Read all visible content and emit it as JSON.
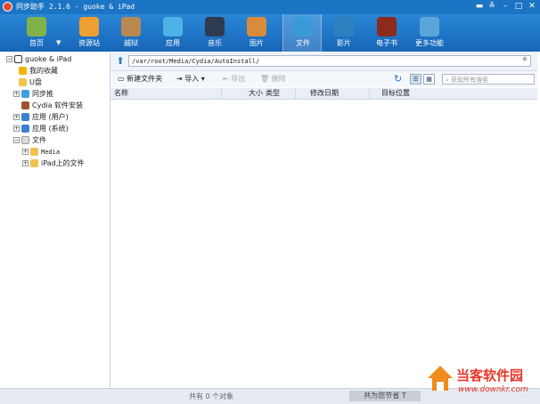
{
  "window": {
    "title": "同步助手 2.1.6 - guoke & iPad"
  },
  "toolbar": {
    "items": [
      {
        "label": "首页",
        "icon": "home-icon",
        "color": "#7fb34a"
      },
      {
        "label": "资源站",
        "icon": "store-bag-icon",
        "color": "#f0a030"
      },
      {
        "label": "越狱",
        "icon": "jailbreak-lock-icon",
        "color": "#b88a52"
      },
      {
        "label": "应用",
        "icon": "apps-grid-icon",
        "color": "#4fb2e6"
      },
      {
        "label": "音乐",
        "icon": "music-note-icon",
        "color": "#2e3b4e"
      },
      {
        "label": "图片",
        "icon": "photo-icon",
        "color": "#d98a3a"
      },
      {
        "label": "文件",
        "icon": "folder-file-icon",
        "color": "#3a9ad9"
      },
      {
        "label": "影片",
        "icon": "video-play-icon",
        "color": "#2e7fc0"
      },
      {
        "label": "电子书",
        "icon": "ebook-icon",
        "color": "#8c2a1e"
      },
      {
        "label": "更多功能",
        "icon": "more-tools-icon",
        "color": "#5aa6d8"
      }
    ],
    "active_index": 6
  },
  "sidebar": {
    "items": [
      {
        "label": "guoke & iPad",
        "icon": "device-icon",
        "color": "#333333"
      },
      {
        "label": "我的收藏",
        "icon": "star-icon",
        "color": "#f2b400"
      },
      {
        "label": "U盘",
        "icon": "folder-icon",
        "color": "#f2c14e"
      },
      {
        "label": "同步推",
        "icon": "sync-push-icon",
        "color": "#3aa0e0"
      },
      {
        "label": "Cydia 软件安装",
        "icon": "cydia-icon",
        "color": "#a0522d"
      },
      {
        "label": "应用 (用户)",
        "icon": "app-store-icon",
        "color": "#3a80d0"
      },
      {
        "label": "应用 (系统)",
        "icon": "app-system-icon",
        "color": "#3a80d0"
      },
      {
        "label": "文件",
        "icon": "folder-icon",
        "color": "#f2c14e"
      },
      {
        "label": "Media",
        "icon": "folder-icon",
        "color": "#f2c14e"
      },
      {
        "label": "iPad上的文件",
        "icon": "folder-icon",
        "color": "#f2c14e"
      }
    ]
  },
  "address": {
    "path": "/var/root/Media/Cydia/AutoInstall/"
  },
  "actions": {
    "new_folder": "新建文件夹",
    "import": "导入",
    "export": "导出",
    "delete": "删除"
  },
  "search": {
    "placeholder": "获取所有搜索"
  },
  "columns": {
    "name": "名称",
    "size": "大小",
    "type": "类型",
    "modified": "修改日期",
    "target": "目标位置"
  },
  "status": {
    "count": "共有 0 个对象",
    "saved": "共为您节省 T"
  },
  "watermark": {
    "brand": "当客软件园",
    "url": "www.downkr.com"
  }
}
